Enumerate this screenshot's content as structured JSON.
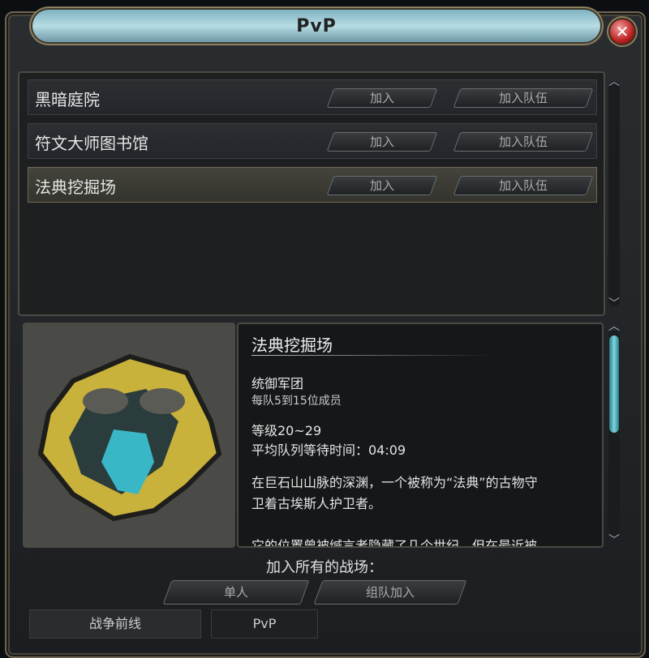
{
  "window": {
    "title": "PvP",
    "close_icon": "close-icon"
  },
  "battlegrounds": [
    {
      "name": "黑暗庭院",
      "join": "加入",
      "join_group": "加入队伍",
      "selected": false
    },
    {
      "name": "符文大师图书馆",
      "join": "加入",
      "join_group": "加入队伍",
      "selected": false
    },
    {
      "name": "法典挖掘场",
      "join": "加入",
      "join_group": "加入队伍",
      "selected": true
    }
  ],
  "detail": {
    "title": "法典挖掘场",
    "faction": "统御军团",
    "team_size": "每队5到15位成员",
    "level": "等级20~29",
    "queue_time": "平均队列等待时间：04:09",
    "description_1": "在巨石山山脉的深渊，一个被称为“法典”的古物守",
    "description_2": "卫着古埃斯人护卫者。",
    "description_3": "它的位置曾被缄言者隐藏了几个世纪，但在最近被"
  },
  "join_all": {
    "label": "加入所有的战场：",
    "solo": "单人",
    "group": "组队加入"
  },
  "tabs": [
    {
      "label": "战争前线",
      "active": true
    },
    {
      "label": "PvP",
      "active": false
    }
  ]
}
